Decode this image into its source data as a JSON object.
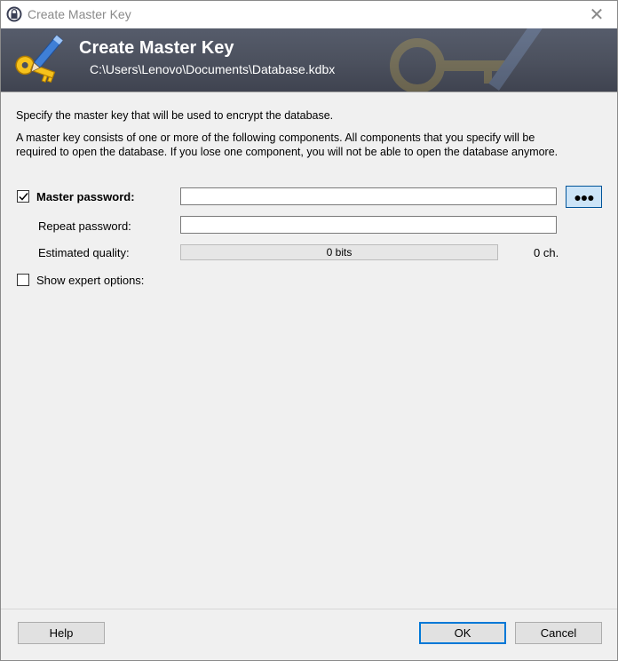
{
  "window": {
    "title": "Create Master Key",
    "close_glyph": "✕"
  },
  "banner": {
    "title": "Create Master Key",
    "subtitle": "C:\\Users\\Lenovo\\Documents\\Database.kdbx",
    "icon": "key-and-pen-icon"
  },
  "intro": {
    "line1": "Specify the master key that will be used to encrypt the database.",
    "line2": "A master key consists of one or more of the following components. All components that you specify will be",
    "line3": "required to open the database. If you lose one component, you will not be able to open the database anymore."
  },
  "form": {
    "master_password_label": "Master password:",
    "master_password_checked": true,
    "master_password_value": "",
    "toggle_button_label": "●●●",
    "repeat_password_label": "Repeat password:",
    "repeat_password_value": "",
    "quality_label": "Estimated quality:",
    "quality_value": "0 bits",
    "quality_fraction": 0,
    "char_count": "0 ch.",
    "expert_options_label": "Show expert options:",
    "expert_options_checked": false
  },
  "footer": {
    "help_label": "Help",
    "ok_label": "OK",
    "cancel_label": "Cancel"
  },
  "colors": {
    "banner": "#4b505d",
    "accent": "#0078d7",
    "toggle_bg": "#cce4f7"
  }
}
